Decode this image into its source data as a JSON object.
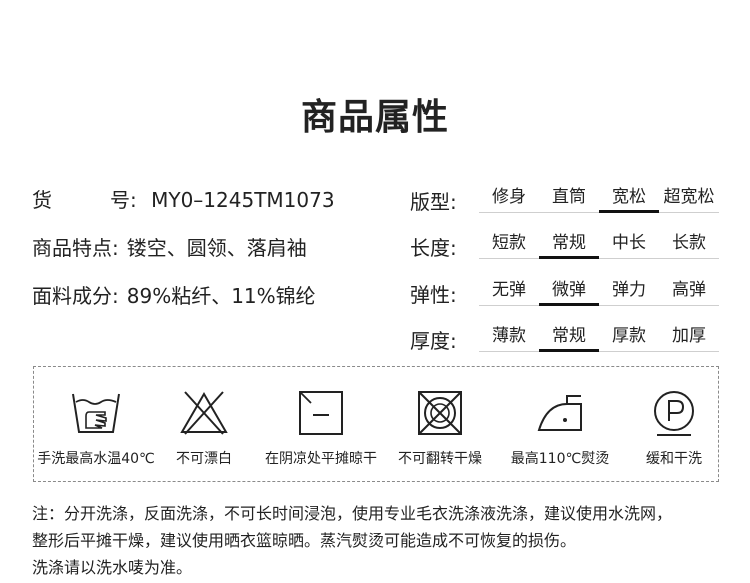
{
  "title": "商品属性",
  "info": {
    "item_no_label_1": "货",
    "item_no_label_2": "号:",
    "item_no_value": "MY0–1245TM1073",
    "features_label": "商品特点:",
    "features_value": "镂空、圆领、落肩袖",
    "material_label": "面料成分:",
    "material_value": "89%粘纤、11%锦纶"
  },
  "attributes": [
    {
      "label": "版型:",
      "options": [
        "修身",
        "直筒",
        "宽松",
        "超宽松"
      ],
      "selected_index": 2
    },
    {
      "label": "长度:",
      "options": [
        "短款",
        "常规",
        "中长",
        "长款"
      ],
      "selected_index": 1
    },
    {
      "label": "弹性:",
      "options": [
        "无弹",
        "微弹",
        "弹力",
        "高弹"
      ],
      "selected_index": 1
    },
    {
      "label": "厚度:",
      "options": [
        "薄款",
        "常规",
        "厚款",
        "加厚"
      ],
      "selected_index": 1
    }
  ],
  "care": [
    {
      "icon": "hand-wash-icon",
      "label": "手洗最高水温40℃"
    },
    {
      "icon": "no-bleach-icon",
      "label": "不可漂白"
    },
    {
      "icon": "shade-flat-dry-icon",
      "label": "在阴凉处平摊晾干"
    },
    {
      "icon": "no-tumble-dry-icon",
      "label": "不可翻转干燥"
    },
    {
      "icon": "iron-low-icon",
      "label": "最高110℃熨烫"
    },
    {
      "icon": "professional-dry-clean-icon",
      "label": "缓和干洗"
    }
  ],
  "notes": [
    "注：分开洗涤，反面洗涤，不可长时间浸泡，使用专业毛衣洗涤液洗涤，建议使用水洗网，",
    "整形后平摊干燥，建议使用晒衣篮晾晒。蒸汽熨烫可能造成不可恢复的损伤。",
    "洗涤请以洗水唛为准。"
  ]
}
